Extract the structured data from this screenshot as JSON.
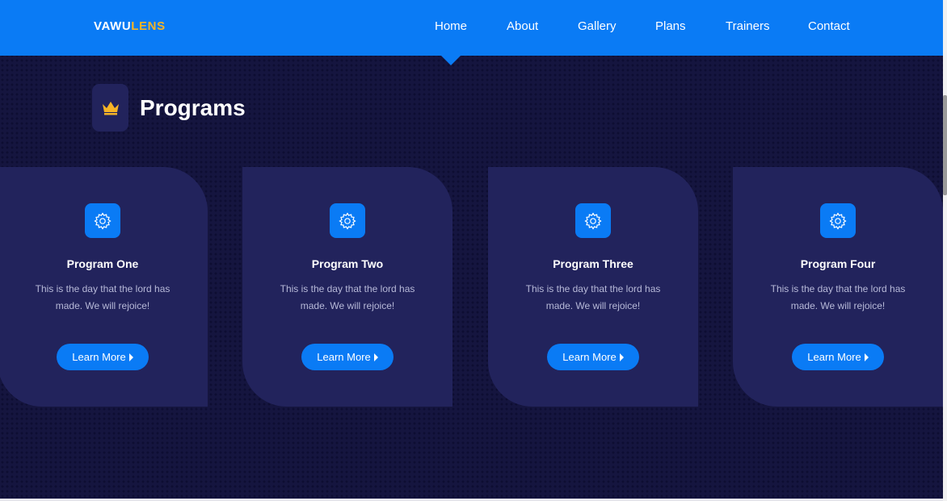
{
  "brand": {
    "primary": "VAWU",
    "accent_text": "LENS",
    "accent_color": "#f6b426",
    "bg_color": "#0a7bf5"
  },
  "nav": {
    "items": [
      {
        "label": "Home"
      },
      {
        "label": "About"
      },
      {
        "label": "Gallery"
      },
      {
        "label": "Plans"
      },
      {
        "label": "Trainers"
      },
      {
        "label": "Contact"
      }
    ],
    "active": "Home"
  },
  "section": {
    "title": "Programs",
    "icon": "crown-icon"
  },
  "programs": [
    {
      "title": "Program One",
      "text": "This is the day that the lord has made. We will rejoice!",
      "button": "Learn More",
      "icon": "gear-icon"
    },
    {
      "title": "Program Two",
      "text": "This is the day that the lord has made. We will rejoice!",
      "button": "Learn More",
      "icon": "gear-icon"
    },
    {
      "title": "Program Three",
      "text": "This is the day that the lord has made. We will rejoice!",
      "button": "Learn More",
      "icon": "gear-icon"
    },
    {
      "title": "Program Four",
      "text": "This is the day that the lord has made. We will rejoice!",
      "button": "Learn More",
      "icon": "gear-icon"
    }
  ]
}
